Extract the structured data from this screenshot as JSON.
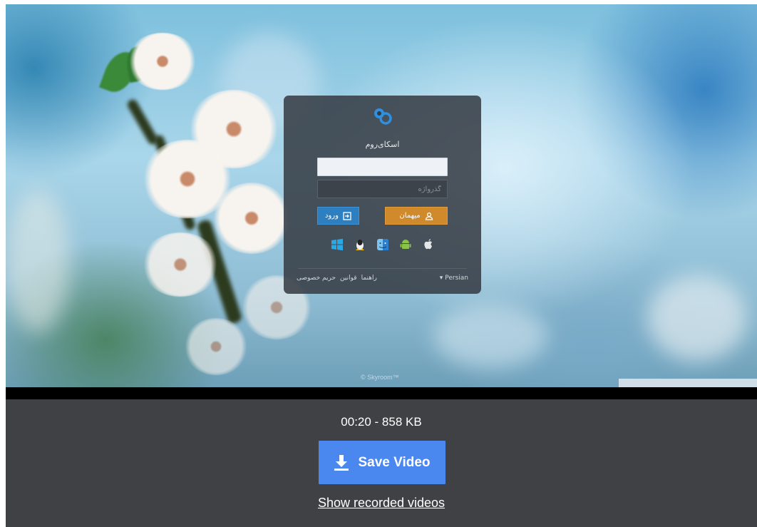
{
  "login_card": {
    "title": "اسکای‌روم",
    "password_placeholder": "گذرواژه",
    "login_label": "ورود",
    "guest_label": "میهمان",
    "footer_links": [
      "راهنما",
      "قوانین",
      "حریم خصوصی"
    ],
    "language": "Persian"
  },
  "preview": {
    "copyright": "© Skyroom™"
  },
  "controls": {
    "meta": "00:20 - 858 KB",
    "save_label": "Save Video",
    "show_recorded_label": "Show recorded videos"
  },
  "icons": {
    "logo": "skyroom-logo-icon",
    "login": "sign-in-icon",
    "guest": "user-icon",
    "download": "download-icon",
    "platforms": [
      "windows-icon",
      "linux-icon",
      "mac-finder-icon",
      "android-icon",
      "apple-icon"
    ]
  },
  "colors": {
    "save_button": "#4a88f0",
    "login_button": "#2e7fc0",
    "guest_button": "#d08a2c",
    "bottom_bar": "#3f4144"
  }
}
